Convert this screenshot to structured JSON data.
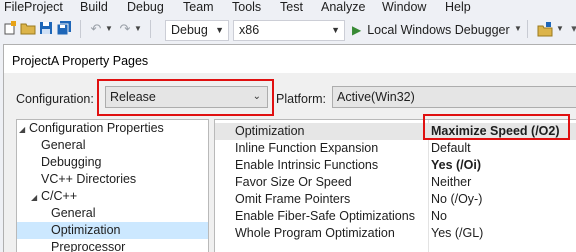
{
  "menubar": {
    "items": [
      "File",
      "Project",
      "Build",
      "Debug",
      "Team",
      "Tools",
      "Test",
      "Analyze",
      "Window",
      "Help"
    ]
  },
  "toolbar": {
    "config_combo": "Debug",
    "platform_combo": "x86",
    "run_label": "Local Windows Debugger"
  },
  "dialog": {
    "title": "ProjectA Property Pages",
    "configuration_label": "Configuration:",
    "configuration_value": "Release",
    "platform_label": "Platform:",
    "platform_value": "Active(Win32)"
  },
  "tree": {
    "items": [
      {
        "label": "Configuration Properties",
        "expander": "◢"
      },
      {
        "label": "General",
        "expander": ""
      },
      {
        "label": "Debugging",
        "expander": ""
      },
      {
        "label": "VC++ Directories",
        "expander": ""
      },
      {
        "label": "C/C++",
        "expander": "◢"
      },
      {
        "label": "General",
        "expander": ""
      },
      {
        "label": "Optimization",
        "expander": ""
      },
      {
        "label": "Preprocessor",
        "expander": ""
      }
    ]
  },
  "properties": {
    "rows": [
      {
        "name": "Optimization",
        "value": "Maximize Speed (/O2)"
      },
      {
        "name": "Inline Function Expansion",
        "value": "Default"
      },
      {
        "name": "Enable Intrinsic Functions",
        "value": "Yes (/Oi)"
      },
      {
        "name": "Favor Size Or Speed",
        "value": "Neither"
      },
      {
        "name": "Omit Frame Pointers",
        "value": "No (/Oy-)"
      },
      {
        "name": "Enable Fiber-Safe Optimizations",
        "value": "No"
      },
      {
        "name": "Whole Program Optimization",
        "value": "Yes (/GL)"
      }
    ]
  },
  "colors": {
    "highlight": "#e01010",
    "selection": "#cce8ff",
    "run_green": "#388a34"
  },
  "icons": [
    "new-project-icon",
    "open-folder-icon",
    "save-icon",
    "save-all-icon",
    "undo-icon",
    "redo-icon",
    "play-icon",
    "toolbar-extra-icon"
  ]
}
